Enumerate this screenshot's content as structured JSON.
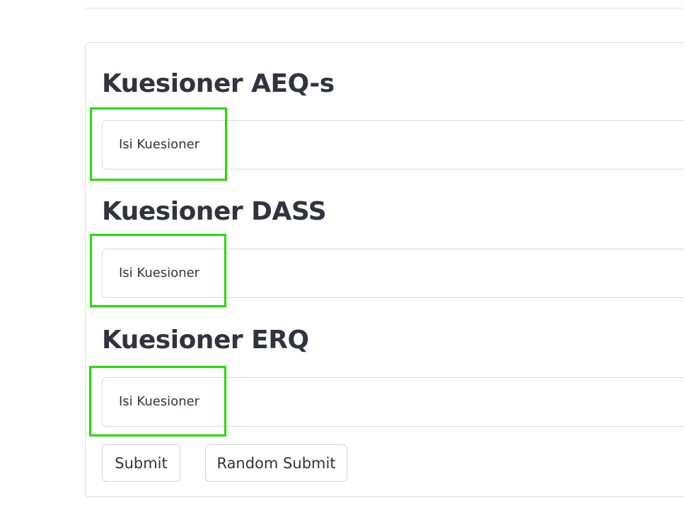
{
  "sections": [
    {
      "title": "Kuesioner AEQ-s",
      "expander_label": "Isi Kuesioner"
    },
    {
      "title": "Kuesioner DASS",
      "expander_label": "Isi Kuesioner"
    },
    {
      "title": "Kuesioner ERQ",
      "expander_label": "Isi Kuesioner"
    }
  ],
  "buttons": {
    "submit_label": "Submit",
    "random_submit_label": "Random Submit"
  },
  "colors": {
    "highlight": "#22dd00",
    "text": "#31333f",
    "border": "#d9dadf"
  }
}
